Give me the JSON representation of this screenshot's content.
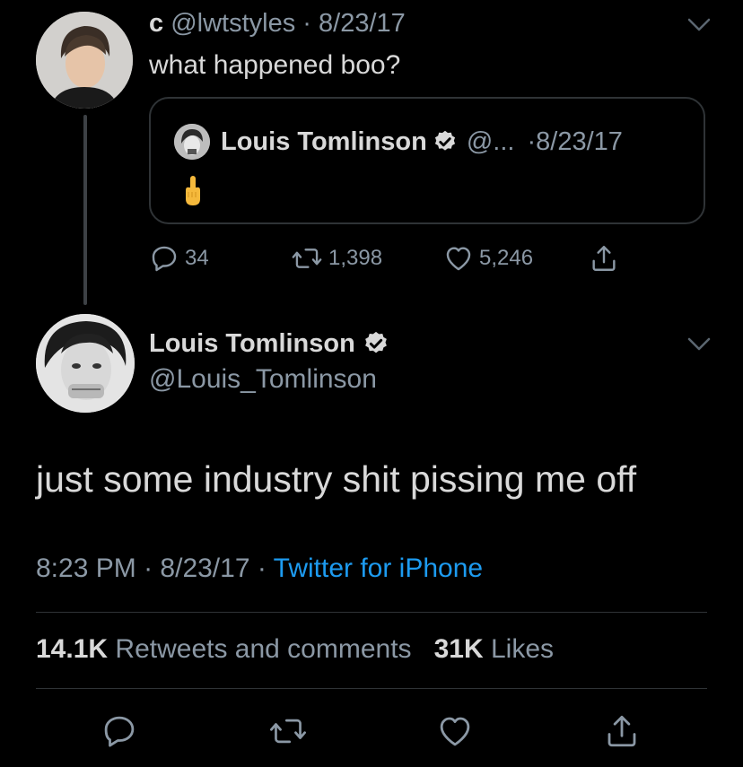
{
  "reply": {
    "user_name": "c",
    "handle": "@lwtstyles",
    "separator": "·",
    "date": "8/23/17",
    "text": "what happened boo?",
    "quoted": {
      "name": "Louis Tomlinson",
      "handle": "@...",
      "separator": "·",
      "date": "8/23/17",
      "body_icon": "middle-finger-emoji"
    },
    "stats": {
      "replies": "34",
      "retweets": "1,398",
      "likes": "5,246"
    }
  },
  "tweet": {
    "name": "Louis Tomlinson",
    "handle": "@Louis_Tomlinson",
    "text": "just some industry shit pissing me off",
    "time": "8:23 PM",
    "date": "8/23/17",
    "separator": "·",
    "source": "Twitter for iPhone",
    "retweets_count": "14.1K",
    "retweets_label": "Retweets and comments",
    "likes_count": "31K",
    "likes_label": "Likes"
  },
  "colors": {
    "background": "#000000",
    "text_primary": "#d9d9d9",
    "text_secondary": "#8b98a5",
    "link": "#1d9bf0",
    "border": "#2f3336"
  }
}
